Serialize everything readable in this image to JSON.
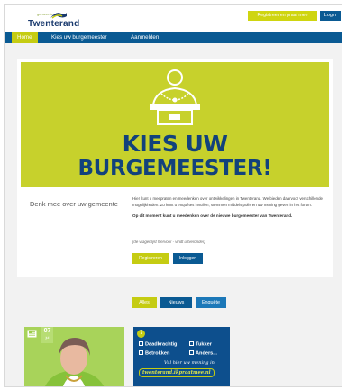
{
  "header": {
    "logo_subtext": "gemeente",
    "logo_text": "Twenterand",
    "register_button": "Registreer en praat mee",
    "login_button": "Login"
  },
  "nav": {
    "items": [
      {
        "label": "Home",
        "active": true
      },
      {
        "label": "Kies uw burgemeester",
        "active": false
      },
      {
        "label": "Aanmelden",
        "active": false
      }
    ]
  },
  "hero": {
    "title_line1": "KIES UW",
    "title_line2": "BURGEMEESTER!",
    "color": "#c7d12c",
    "title_color": "#12427c"
  },
  "intro": {
    "side_title": "Denk mee over uw gemeente",
    "body": "Hier kunt u meepraten en meedenken over ontwikkelingen in Twenterand. We bieden daarvoor verschillende mogelijkheden. Zo kunt u enquêtes invullen, stemmen middels polls en uw mening geven in het forum.",
    "bold": "Op dit moment kunt u meedenken over de nieuwe burgemeester van Twenterand.",
    "note": "(de vragenlijst hiervoor - vindt u hieronder)",
    "register_button": "Registreren",
    "login_button": "Inloggen"
  },
  "filters": [
    {
      "label": "Alles",
      "color": "#c5cc12"
    },
    {
      "label": "Nieuws",
      "color": "#0a5a93"
    },
    {
      "label": "Enquête",
      "color": "#1c78b8"
    }
  ],
  "tiles": {
    "news": {
      "day": "07",
      "month": "jul",
      "icon": "newspaper-icon"
    },
    "survey": {
      "badge": "?",
      "options": [
        "Daadkrachtig",
        "Tukker",
        "Betrokken",
        "Anders..."
      ],
      "script": "Vul hier uw mening in",
      "url": "twenterand.ikpraatmee.nl"
    }
  },
  "colors": {
    "accent_yellow": "#c5cc12",
    "brand_blue": "#0a5a93"
  }
}
